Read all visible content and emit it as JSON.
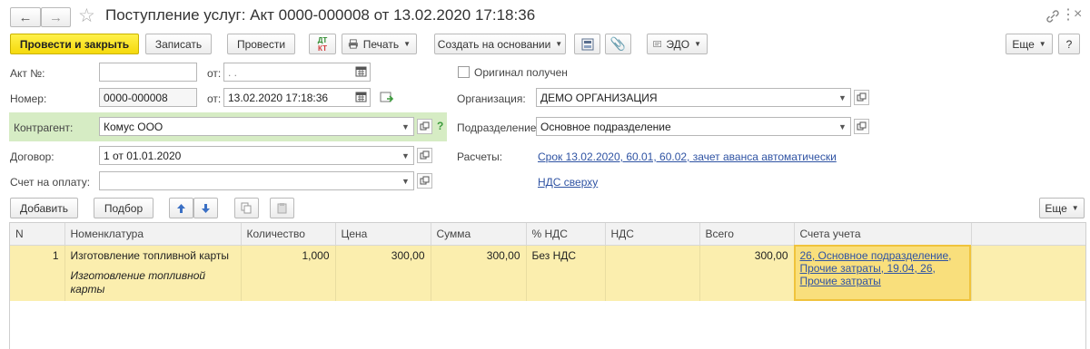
{
  "window": {
    "title": "Поступление услуг: Акт 0000-000008 от 13.02.2020 17:18:36"
  },
  "toolbar": {
    "post_close_label": "Провести и закрыть",
    "save_label": "Записать",
    "post_label": "Провести",
    "dtkt_top": "ДТ",
    "dtkt_bottom": "КТ",
    "print_label": "Печать",
    "create_based_label": "Создать на основании",
    "edo_label": "ЭДО",
    "more_label": "Еще",
    "help_label": "?"
  },
  "form": {
    "act_no_label": "Акт №:",
    "act_no_value": "",
    "act_date_label": "от:",
    "act_date_value": ". .",
    "number_label": "Номер:",
    "number_value": "0000-000008",
    "date_label": "от:",
    "date_value": "13.02.2020 17:18:36",
    "contractor_label": "Контрагент:",
    "contractor_value": "Комус ООО",
    "contractor_help": "?",
    "contract_label": "Договор:",
    "contract_value": "1 от 01.01.2020",
    "invoice_label": "Счет на оплату:",
    "invoice_value": "",
    "original_received_label": "Оригинал получен",
    "original_received_checked": false,
    "organization_label": "Организация:",
    "organization_value": "ДЕМО ОРГАНИЗАЦИЯ",
    "department_label": "Подразделение:",
    "department_value": "Основное подразделение",
    "settlements_label": "Расчеты:",
    "settlements_link": "Срок 13.02.2020, 60.01, 60.02, зачет аванса автоматически",
    "vat_link": "НДС сверху"
  },
  "table_toolbar": {
    "add_label": "Добавить",
    "pick_label": "Подбор",
    "more_label": "Еще"
  },
  "table": {
    "columns": [
      "N",
      "Номенклатура",
      "Количество",
      "Цена",
      "Сумма",
      "% НДС",
      "НДС",
      "Всего",
      "Счета учета"
    ],
    "rows": [
      {
        "n": "1",
        "item": "Изготовление топливной карты",
        "item_description": "Изготовление топливной карты",
        "quantity": "1,000",
        "price": "300,00",
        "sum": "300,00",
        "vat_rate": "Без НДС",
        "vat": "",
        "total": "300,00",
        "accounts": "26, Основное подразделение, Прочие затраты, 19.04, 26, Прочие затраты"
      }
    ]
  },
  "colors": {
    "primary_button": "#f5d90c",
    "contractor_highlight": "#d6ecc4",
    "selected_row": "#fbeeae",
    "link": "#2f53a3",
    "active_cell_border": "#f0c33c"
  }
}
